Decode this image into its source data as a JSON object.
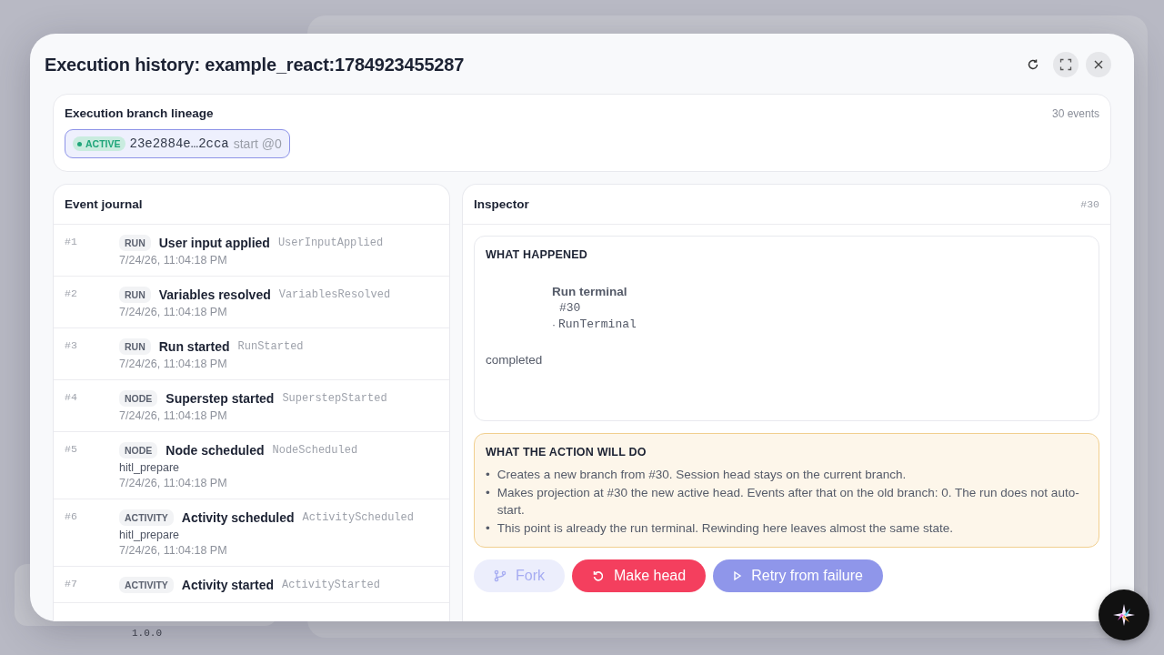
{
  "background": {
    "version": "1.0.0"
  },
  "dialog": {
    "title": "Execution history: example_react:1784923455287"
  },
  "lineage": {
    "title": "Execution branch lineage",
    "count": "30 events",
    "branches": [
      {
        "status": "ACTIVE",
        "selected": true,
        "id": "23e2884e…2cca",
        "origin": "start @0"
      }
    ]
  },
  "journal": {
    "title": "Event journal",
    "events": [
      {
        "number": "#1",
        "category": "RUN",
        "title": "User input applied",
        "type": "UserInputApplied",
        "time": "7/24/26, 11:04:18 PM"
      },
      {
        "number": "#2",
        "category": "RUN",
        "title": "Variables resolved",
        "type": "VariablesResolved",
        "time": "7/24/26, 11:04:18 PM"
      },
      {
        "number": "#3",
        "category": "RUN",
        "title": "Run started",
        "type": "RunStarted",
        "time": "7/24/26, 11:04:18 PM"
      },
      {
        "number": "#4",
        "category": "NODE",
        "title": "Superstep started",
        "type": "SuperstepStarted",
        "time": "7/24/26, 11:04:18 PM"
      },
      {
        "number": "#5",
        "category": "NODE",
        "title": "Node scheduled",
        "type": "NodeScheduled",
        "detail": "hitl_prepare",
        "time": "7/24/26, 11:04:18 PM"
      },
      {
        "number": "#6",
        "category": "ACTIVITY",
        "title": "Activity scheduled",
        "type": "ActivityScheduled",
        "detail": "hitl_prepare",
        "time": "7/24/26, 11:04:18 PM"
      },
      {
        "number": "#7",
        "category": "ACTIVITY",
        "title": "Activity started",
        "type": "ActivityStarted"
      }
    ]
  },
  "inspector": {
    "title": "Inspector",
    "selected_event": "#30",
    "what_happened": {
      "heading": "WHAT HAPPENED",
      "event_title": "Run terminal",
      "event_number": "#30",
      "separator": "·",
      "event_type": "RunTerminal",
      "result": "completed"
    },
    "action": {
      "heading": "WHAT THE ACTION WILL DO",
      "items": [
        {
          "bullet": "•",
          "text": "Creates a new branch from #30. Session head stays on the current branch."
        },
        {
          "bullet": "•",
          "text": "Makes projection at #30 the new active head. Events after that on the old branch: 0. The run does not auto-start."
        },
        {
          "bullet": "•",
          "text": "This point is already the run terminal. Rewinding here leaves almost the same state."
        }
      ]
    },
    "buttons": [
      {
        "kind": "fork",
        "label": "Fork",
        "disabled": true
      },
      {
        "kind": "rewind",
        "label": "Make head",
        "disabled": false
      },
      {
        "kind": "retry",
        "label": "Retry from failure",
        "disabled": true
      }
    ]
  }
}
